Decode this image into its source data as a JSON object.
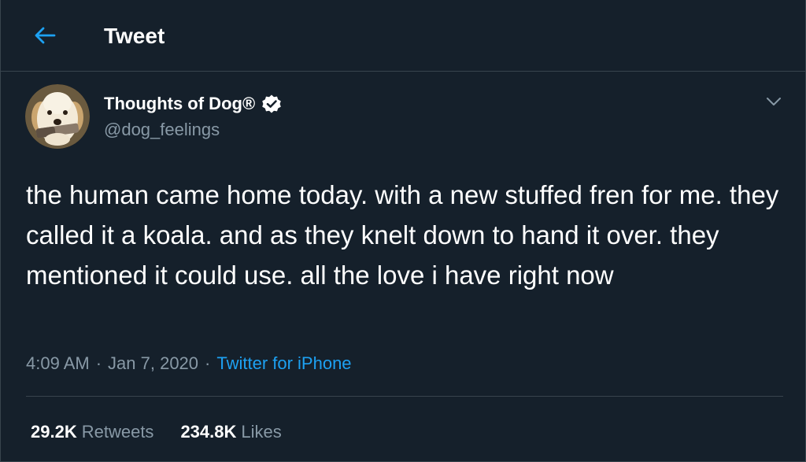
{
  "header": {
    "back_icon": "arrow-left-icon",
    "title": "Tweet"
  },
  "author": {
    "display_name": "Thoughts of Dog®",
    "handle": "@dog_feelings",
    "verified_icon": "verified-badge-icon",
    "avatar": "dog-avatar"
  },
  "more_icon": "chevron-down-icon",
  "tweet": {
    "text": "the human came home today. with a new stuffed fren for me. they called it a koala. and as they knelt down to hand it over. they mentioned it could use. all the love i have right now",
    "time": "4:09 AM",
    "separator": "·",
    "date": "Jan 7, 2020",
    "source": "Twitter for iPhone"
  },
  "stats": {
    "retweets_count": "29.2K",
    "retweets_label": "Retweets",
    "likes_count": "234.8K",
    "likes_label": "Likes"
  },
  "colors": {
    "background": "#15202b",
    "border": "#38444d",
    "text_primary": "#ffffff",
    "text_secondary": "#8899a6",
    "accent": "#1da1f2"
  }
}
